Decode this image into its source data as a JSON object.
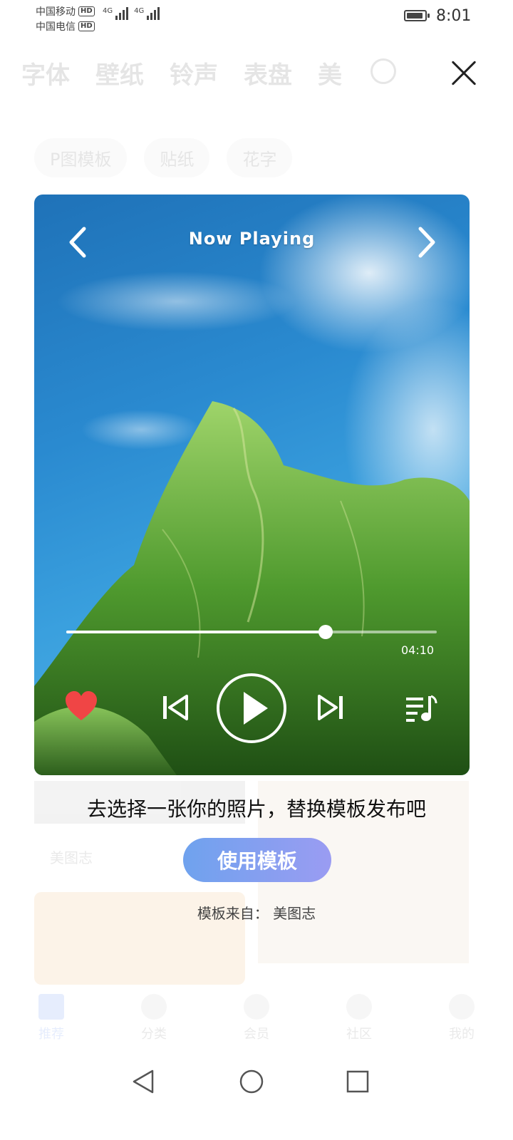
{
  "status_bar": {
    "carrier1": "中国移动",
    "carrier2": "中国电信",
    "hd": "HD",
    "network1": "4G",
    "network2": "4G",
    "time": "8:01"
  },
  "background_app": {
    "tabs": [
      "字体",
      "壁纸",
      "铃声",
      "表盘",
      "美"
    ],
    "chips": [
      "P图模板",
      "贴纸",
      "花字"
    ],
    "author": "美图志",
    "nav": [
      "推荐",
      "分类",
      "会员",
      "社区",
      "我的"
    ]
  },
  "preview": {
    "title": "Now Playing",
    "elapsed_fraction": 0.7,
    "duration": "04:10"
  },
  "sheet": {
    "tagline": "去选择一张你的照片，替换模板发布吧",
    "button": "使用模板",
    "source_label": "模板来自：",
    "source_name": "美图志"
  },
  "icons": {
    "close": "close-icon",
    "back": "chevron-left-icon",
    "next": "chevron-right-icon",
    "heart": "heart-icon",
    "prev": "skip-previous-icon",
    "play": "play-icon",
    "skip": "skip-next-icon",
    "playlist": "playlist-icon"
  },
  "colors": {
    "button_start": "#6fa2ee",
    "button_end": "#9a9cf2",
    "heart": "#f04545",
    "sky": "#2a8ad0"
  }
}
